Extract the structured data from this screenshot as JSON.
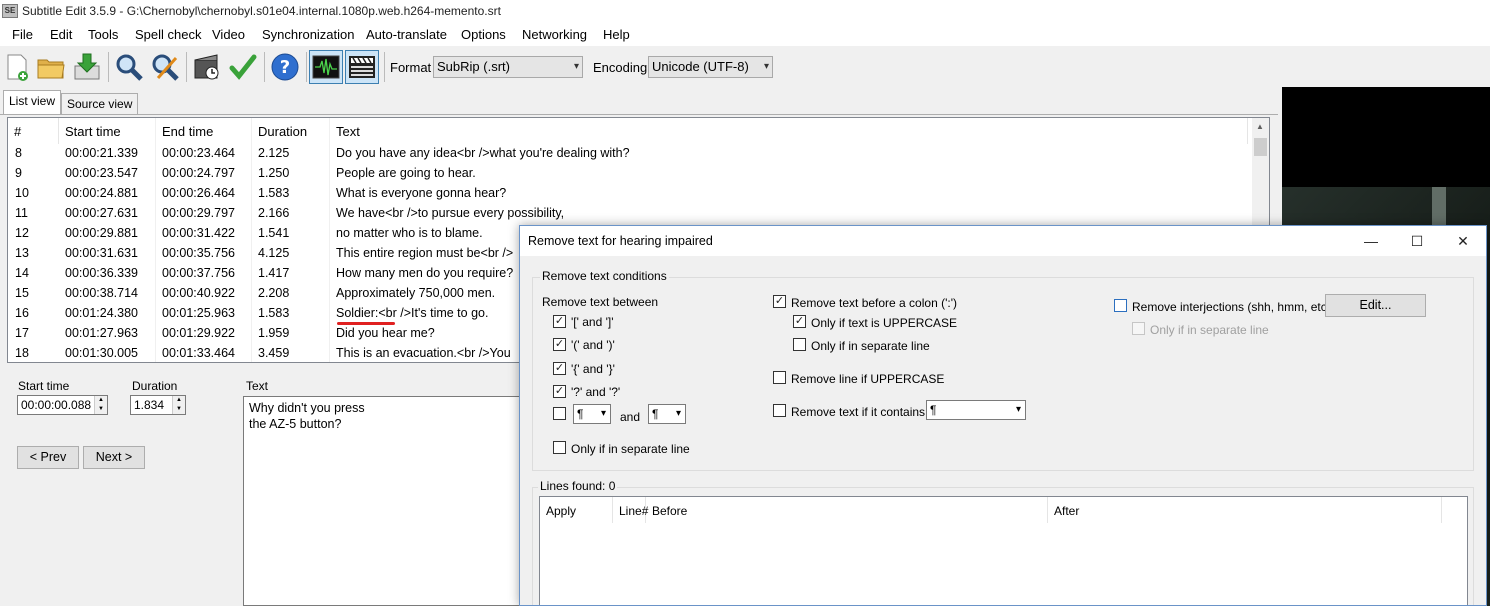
{
  "window": {
    "title": "Subtitle Edit 3.5.9 - G:\\Chernobyl\\chernobyl.s01e04.internal.1080p.web.h264-memento.srt",
    "icon_label": "SE"
  },
  "menu": [
    "File",
    "Edit",
    "Tools",
    "Spell check",
    "Video",
    "Synchronization",
    "Auto-translate",
    "Options",
    "Networking",
    "Help"
  ],
  "toolbar": {
    "icons": [
      "new-file-icon",
      "open-folder-icon",
      "download-save-icon",
      "find-icon",
      "replace-icon",
      "visual-sync-icon",
      "spell-check-icon",
      "help-icon",
      "waveform-icon",
      "video-clapper-icon"
    ],
    "format_label": "Format",
    "format_value": "SubRip (.srt)",
    "encoding_label": "Encoding",
    "encoding_value": "Unicode (UTF-8)"
  },
  "tabs": [
    "List view",
    "Source view"
  ],
  "list": {
    "columns": [
      "#",
      "Start time",
      "End time",
      "Duration",
      "Text"
    ],
    "rows": [
      [
        "8",
        "00:00:21.339",
        "00:00:23.464",
        "2.125",
        "Do you have any idea<br />what you're dealing with?"
      ],
      [
        "9",
        "00:00:23.547",
        "00:00:24.797",
        "1.250",
        "People are going to hear."
      ],
      [
        "10",
        "00:00:24.881",
        "00:00:26.464",
        "1.583",
        "What is everyone gonna hear?"
      ],
      [
        "11",
        "00:00:27.631",
        "00:00:29.797",
        "2.166",
        "We have<br />to pursue every possibility,"
      ],
      [
        "12",
        "00:00:29.881",
        "00:00:31.422",
        "1.541",
        "no matter who is to blame."
      ],
      [
        "13",
        "00:00:31.631",
        "00:00:35.756",
        "4.125",
        "This entire region must be<br />"
      ],
      [
        "14",
        "00:00:36.339",
        "00:00:37.756",
        "1.417",
        "How many men do you require?"
      ],
      [
        "15",
        "00:00:38.714",
        "00:00:40.922",
        "2.208",
        "Approximately 750,000 men."
      ],
      [
        "16",
        "00:01:24.380",
        "00:01:25.963",
        "1.583",
        "Soldier:<br />It's time to go."
      ],
      [
        "17",
        "00:01:27.963",
        "00:01:29.922",
        "1.959",
        "Did you hear me?"
      ],
      [
        "18",
        "00:01:30.005",
        "00:01:33.464",
        "3.459",
        "This is an evacuation.<br />You"
      ]
    ]
  },
  "editor": {
    "start_time_label": "Start time",
    "start_time_value": "00:00:00.088",
    "duration_label": "Duration",
    "duration_value": "1.834",
    "text_label": "Text",
    "text_value": "Why didn't you press\nthe AZ-5 button?",
    "prev_label": "< Prev",
    "next_label": "Next >"
  },
  "dialog": {
    "title": "Remove text for hearing impaired",
    "conditions_title": "Remove text conditions",
    "between_label": "Remove text between",
    "pairs": [
      {
        "label": "'[' and ']'",
        "checked": true
      },
      {
        "label": "'(' and ')'",
        "checked": true
      },
      {
        "label": "'{' and '}'",
        "checked": true
      },
      {
        "label": "'?' and '?'",
        "checked": true
      }
    ],
    "custom_start": "¶",
    "custom_and": "and",
    "custom_end": "¶",
    "only_separate_line_1": "Only if in separate line",
    "before_colon": "Remove text before a colon (':')",
    "only_uppercase": "Only if text is UPPERCASE",
    "only_separate_line_2": "Only if in separate line",
    "remove_line_uppercase": "Remove line if UPPERCASE",
    "remove_if_contains": "Remove text if it contains:",
    "contains_value": "¶",
    "interjections": "Remove interjections (shh, hmm, etc.)",
    "edit_button": "Edit...",
    "only_separate_line_3": "Only if in separate line",
    "lines_found": "Lines found: 0",
    "lines_columns": [
      "Apply",
      "Line#",
      "Before",
      "After"
    ]
  }
}
